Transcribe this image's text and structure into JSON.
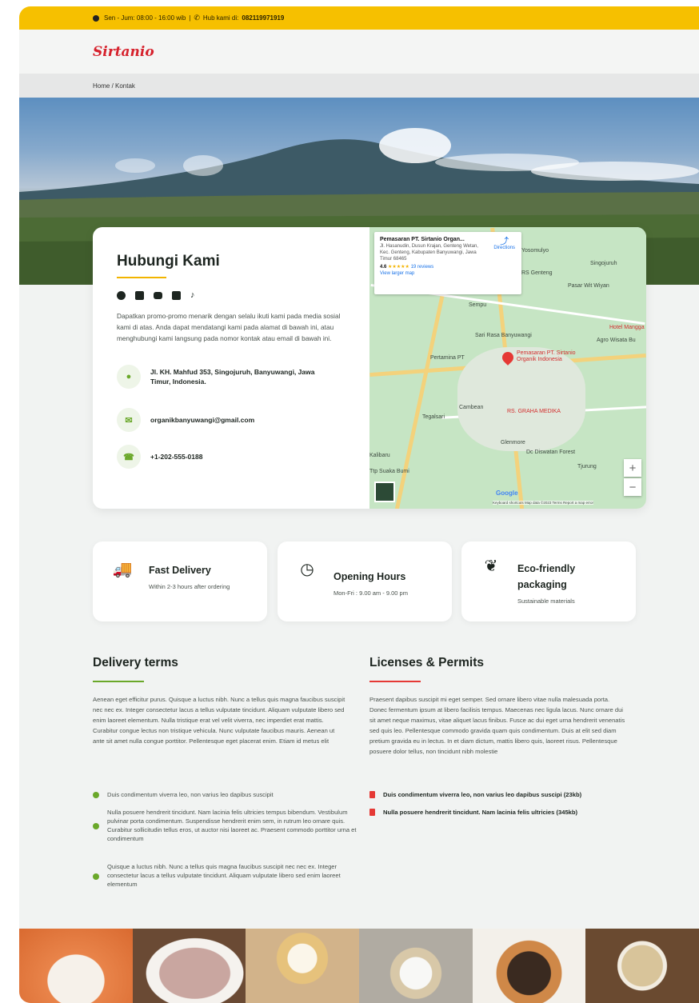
{
  "topbar": {
    "hours": "Sen - Jum: 08:00 - 16:00 wib",
    "separator": "|",
    "phone_prefix": "Hub kami di:",
    "phone": "082119971919"
  },
  "header": {
    "logo": "Sirtanio"
  },
  "breadcrumb": "Home / Kontak",
  "contact": {
    "title": "Hubungi Kami",
    "socials": [
      "facebook-icon",
      "twitter-icon",
      "youtube-icon",
      "linkedin-icon",
      "tiktok-icon"
    ],
    "description": "Dapatkan promo-promo menarik dengan selalu ikuti kami pada media sosial kami di atas. Anda dapat mendatangi kami pada alamat di bawah ini, atau menghubungi kami langsung pada nomor kontak atau email di bawah ini.",
    "address": "Jl. KH. Mahfud 353, Singojuruh, Banyuwangi, Jawa Timur, Indonesia.",
    "email": "organikbanyuwangi@gmail.com",
    "phone": "+1-202-555-0188"
  },
  "map": {
    "card_title": "Pemasaran PT. Sirtanio Organ...",
    "card_address": "Jl. Hasanudin, Dusun Krajan, Genteng Wetan, Kec. Genteng, Kabupaten Banyuwangi, Jawa Timur 68465",
    "rating": "4.6",
    "stars": "★★★★★",
    "reviews": "19 reviews",
    "directions": "Directions",
    "larger_map": "View larger map",
    "pin_label": "Pemasaran PT. Sirtanio Organik Indonesia",
    "labels": [
      "Yosomulyo",
      "Singojuruh",
      "Sempu",
      "Sari Rasa Banyuwangi",
      "Pertamina PT",
      "Cambean",
      "RS. GRAHA MEDIKA",
      "Tegalsari",
      "Glenmore",
      "Dc Diswatan Forest",
      "Tjurung",
      "Kalibaru",
      "Ttp Suaka Bumi",
      "Hotel Mangga",
      "Agro Wisata Bu",
      "Pasar Wit Wiyan",
      "RS Genteng"
    ],
    "zoom_in": "+",
    "zoom_out": "−",
    "footer": "Keyboard shortcuts   Map data ©2023   Terms   Report a map error",
    "google": "Google"
  },
  "features": [
    {
      "icon": "truck-icon",
      "glyph": "🚚",
      "title": "Fast Delivery",
      "text": "Within 2-3 hours after ordering"
    },
    {
      "icon": "clock-icon",
      "glyph": "◷",
      "title": "Opening Hours",
      "text": "Mon-Fri : 9.00 am - 9.00 pm"
    },
    {
      "icon": "leaf-icon",
      "glyph": "❦",
      "title": "Eco-friendly packaging",
      "text": "Sustainable materials"
    }
  ],
  "delivery": {
    "title": "Delivery terms",
    "para": "Aenean eget efficitur purus. Quisque a luctus nibh. Nunc a tellus quis magna faucibus suscipit nec nec ex. Integer consectetur lacus a tellus vulputate tincidunt. Aliquam vulputate libero sed enim laoreet elementum. Nulla tristique erat vel velit viverra, nec imperdiet erat mattis. Curabitur congue lectus non tristique vehicula. Nunc vulputate faucibus mauris. Aenean ut ante sit amet nulla congue porttitor. Pellentesque eget placerat enim. Etiam id metus elit",
    "items": [
      "Duis condimentum viverra leo, non varius leo dapibus suscipit",
      "Nulla posuere hendrerit tincidunt. Nam lacinia felis ultricies tempus bibendum. Vestibulum pulvinar porta condimentum. Suspendisse hendrerit enim sem, in rutrum leo ornare quis. Curabitur sollicitudin tellus eros, ut auctor nisi laoreet ac. Praesent commodo porttitor urna et condimentum",
      "Quisque a luctus nibh. Nunc a tellus quis magna faucibus suscipit nec nec ex. Integer consectetur lacus a tellus vulputate tincidunt. Aliquam vulputate libero sed enim laoreet elementum"
    ]
  },
  "licenses": {
    "title": "Licenses & Permits",
    "para": "Praesent dapibus suscipit mi eget semper. Sed ornare libero vitae nulla malesuada porta. Donec fermentum ipsum at libero facilisis tempus. Maecenas nec ligula lacus. Nunc ornare dui sit amet neque maximus, vitae aliquet lacus finibus. Fusce ac dui eget urna hendrerit venenatis sed quis leo. Pellentesque commodo gravida quam quis condimentum. Duis at elit sed diam pretium gravida eu in lectus. In et diam dictum, mattis libero quis, laoreet risus. Pellentesque posuere dolor tellus, non tincidunt nibh molestie",
    "files": [
      "Duis condimentum viverra leo, non varius leo dapibus suscipi (23kb)",
      "Nulla posuere hendrerit tincidunt. Nam lacinia felis ultricies (345kb)"
    ]
  },
  "colors": {
    "accent_yellow": "#f6c000",
    "brand_red": "#d6212c",
    "green": "#6aa82a",
    "red": "#e53935"
  }
}
